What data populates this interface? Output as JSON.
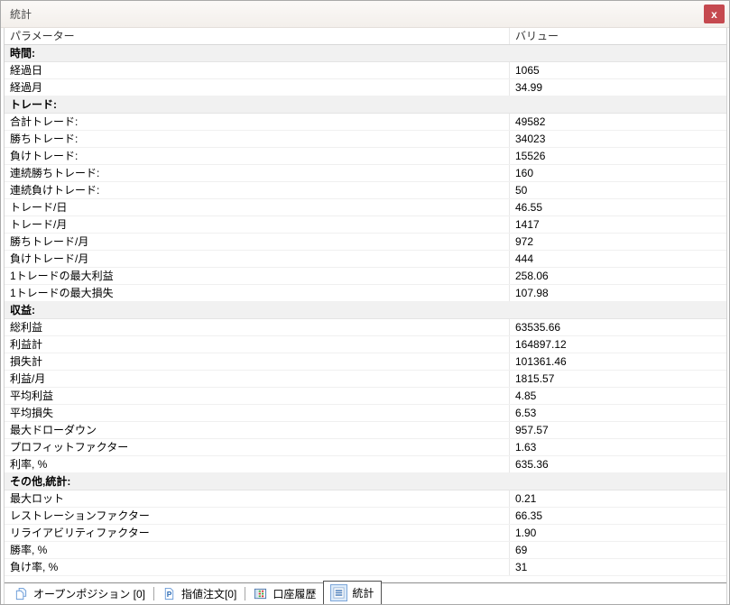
{
  "window": {
    "title": "統計",
    "close_label": "x"
  },
  "table": {
    "columns": [
      "パラメーター",
      "バリュー"
    ],
    "rows": [
      {
        "type": "section",
        "label": "時間:"
      },
      {
        "type": "data",
        "label": "経過日",
        "value": "1065"
      },
      {
        "type": "data",
        "label": "経過月",
        "value": "34.99"
      },
      {
        "type": "section",
        "label": "トレード:"
      },
      {
        "type": "data",
        "label": "合計トレード:",
        "value": "49582"
      },
      {
        "type": "data",
        "label": "勝ちトレード:",
        "value": "34023"
      },
      {
        "type": "data",
        "label": "負けトレード:",
        "value": "15526"
      },
      {
        "type": "data",
        "label": "連続勝ちトレード:",
        "value": "160"
      },
      {
        "type": "data",
        "label": "連続負けトレード:",
        "value": "50"
      },
      {
        "type": "data",
        "label": "トレード/日",
        "value": "46.55"
      },
      {
        "type": "data",
        "label": "トレード/月",
        "value": "1417"
      },
      {
        "type": "data",
        "label": "勝ちトレード/月",
        "value": "972"
      },
      {
        "type": "data",
        "label": "負けトレード/月",
        "value": "444"
      },
      {
        "type": "data",
        "label": "1トレードの最大利益",
        "value": "258.06"
      },
      {
        "type": "data",
        "label": "1トレードの最大損失",
        "value": "107.98"
      },
      {
        "type": "section",
        "label": "収益:"
      },
      {
        "type": "data",
        "label": "総利益",
        "value": "63535.66"
      },
      {
        "type": "data",
        "label": "利益計",
        "value": "164897.12"
      },
      {
        "type": "data",
        "label": "損失計",
        "value": "101361.46"
      },
      {
        "type": "data",
        "label": "利益/月",
        "value": "1815.57"
      },
      {
        "type": "data",
        "label": "平均利益",
        "value": "4.85"
      },
      {
        "type": "data",
        "label": "平均損失",
        "value": "6.53"
      },
      {
        "type": "data",
        "label": "最大ドローダウン",
        "value": "957.57"
      },
      {
        "type": "data",
        "label": "プロフィットファクター",
        "value": "1.63"
      },
      {
        "type": "data",
        "label": "利率, %",
        "value": "635.36"
      },
      {
        "type": "section",
        "label": "その他,統計:"
      },
      {
        "type": "data",
        "label": "最大ロット",
        "value": "0.21"
      },
      {
        "type": "data",
        "label": "レストレーションファクター",
        "value": "66.35"
      },
      {
        "type": "data",
        "label": "リライアビリティファクター",
        "value": "1.90"
      },
      {
        "type": "data",
        "label": "勝率, %",
        "value": "69"
      },
      {
        "type": "data",
        "label": "負け率, %",
        "value": "31"
      }
    ]
  },
  "tabs": [
    {
      "name": "tab-open-positions",
      "label": "オープンポジション [0]",
      "icon": "documents-icon",
      "active": false
    },
    {
      "name": "tab-pending-orders",
      "label": "指値注文[0]",
      "icon": "page-p-icon",
      "active": false
    },
    {
      "name": "tab-account-history",
      "label": "口座履歴",
      "icon": "grid-table-icon",
      "active": false
    },
    {
      "name": "tab-statistics",
      "label": "統計",
      "icon": "list-lines-icon",
      "active": true
    }
  ],
  "colors": {
    "close_button_red": "#c5494f",
    "tab_icon_blue": "#6a9bd8",
    "section_row_bg": "#f1f1f1"
  }
}
